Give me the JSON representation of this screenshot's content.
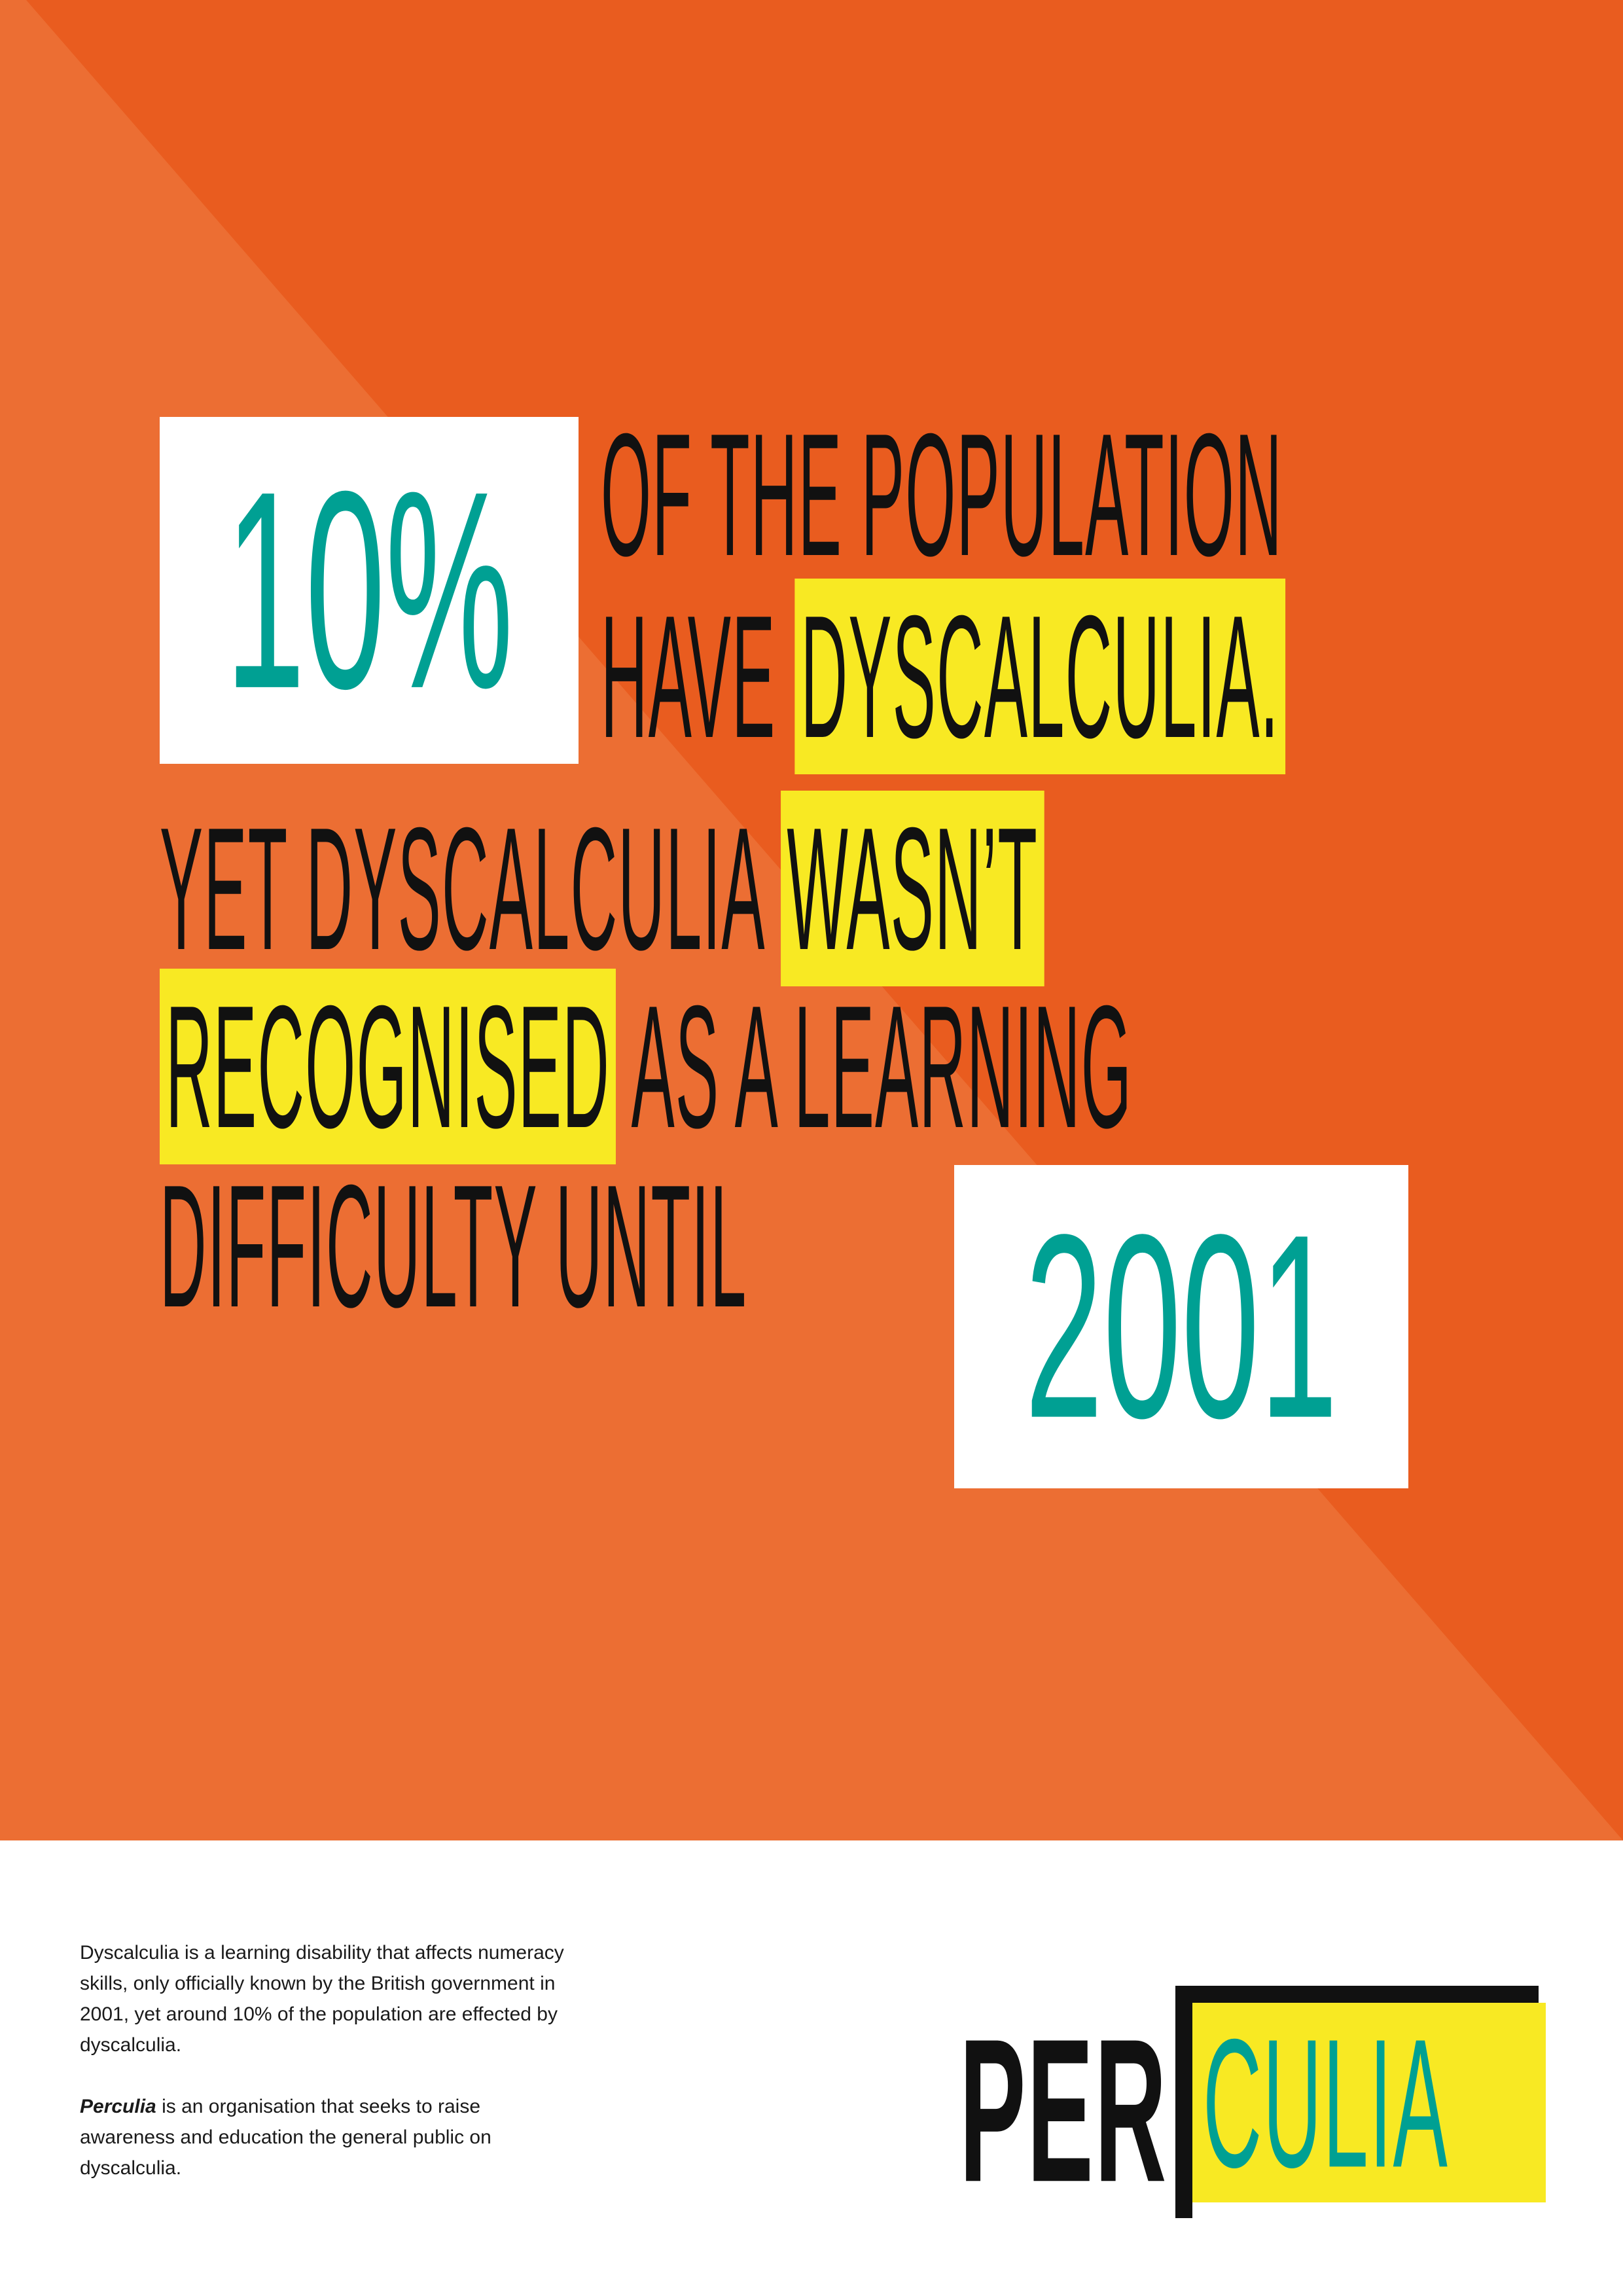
{
  "colors": {
    "orange_light": "#ec6e33",
    "orange_dark": "#e95c1f",
    "yellow_highlight": "#f8e923",
    "teal_accent": "#00a093",
    "text_black": "#111111",
    "white": "#ffffff"
  },
  "headline": {
    "stat_percent": "10%",
    "line1": "OF THE POPULATION",
    "line2_plain": "HAVE",
    "line2_highlight": "DYSCALCULIA.",
    "line3_plain": "YET DYSCALCULIA",
    "line3_highlight": "WASN’T",
    "line4_highlight": "RECOGNISED",
    "line4_plain": "AS A LEARNING",
    "line5_plain": "DIFFICULTY UNTIL",
    "stat_year": "2001"
  },
  "footer": {
    "paragraph1": "Dyscalculia is a learning disability that affects numeracy skills, only officially known by the British government in 2001, yet around 10% of the population are effected by dyscalculia.",
    "paragraph2_brand": "Perculia",
    "paragraph2_rest": " is an organisation that seeks to raise awareness and education the general public on dyscalculia."
  },
  "logo": {
    "part1": "PER",
    "part2": "CULIA"
  }
}
